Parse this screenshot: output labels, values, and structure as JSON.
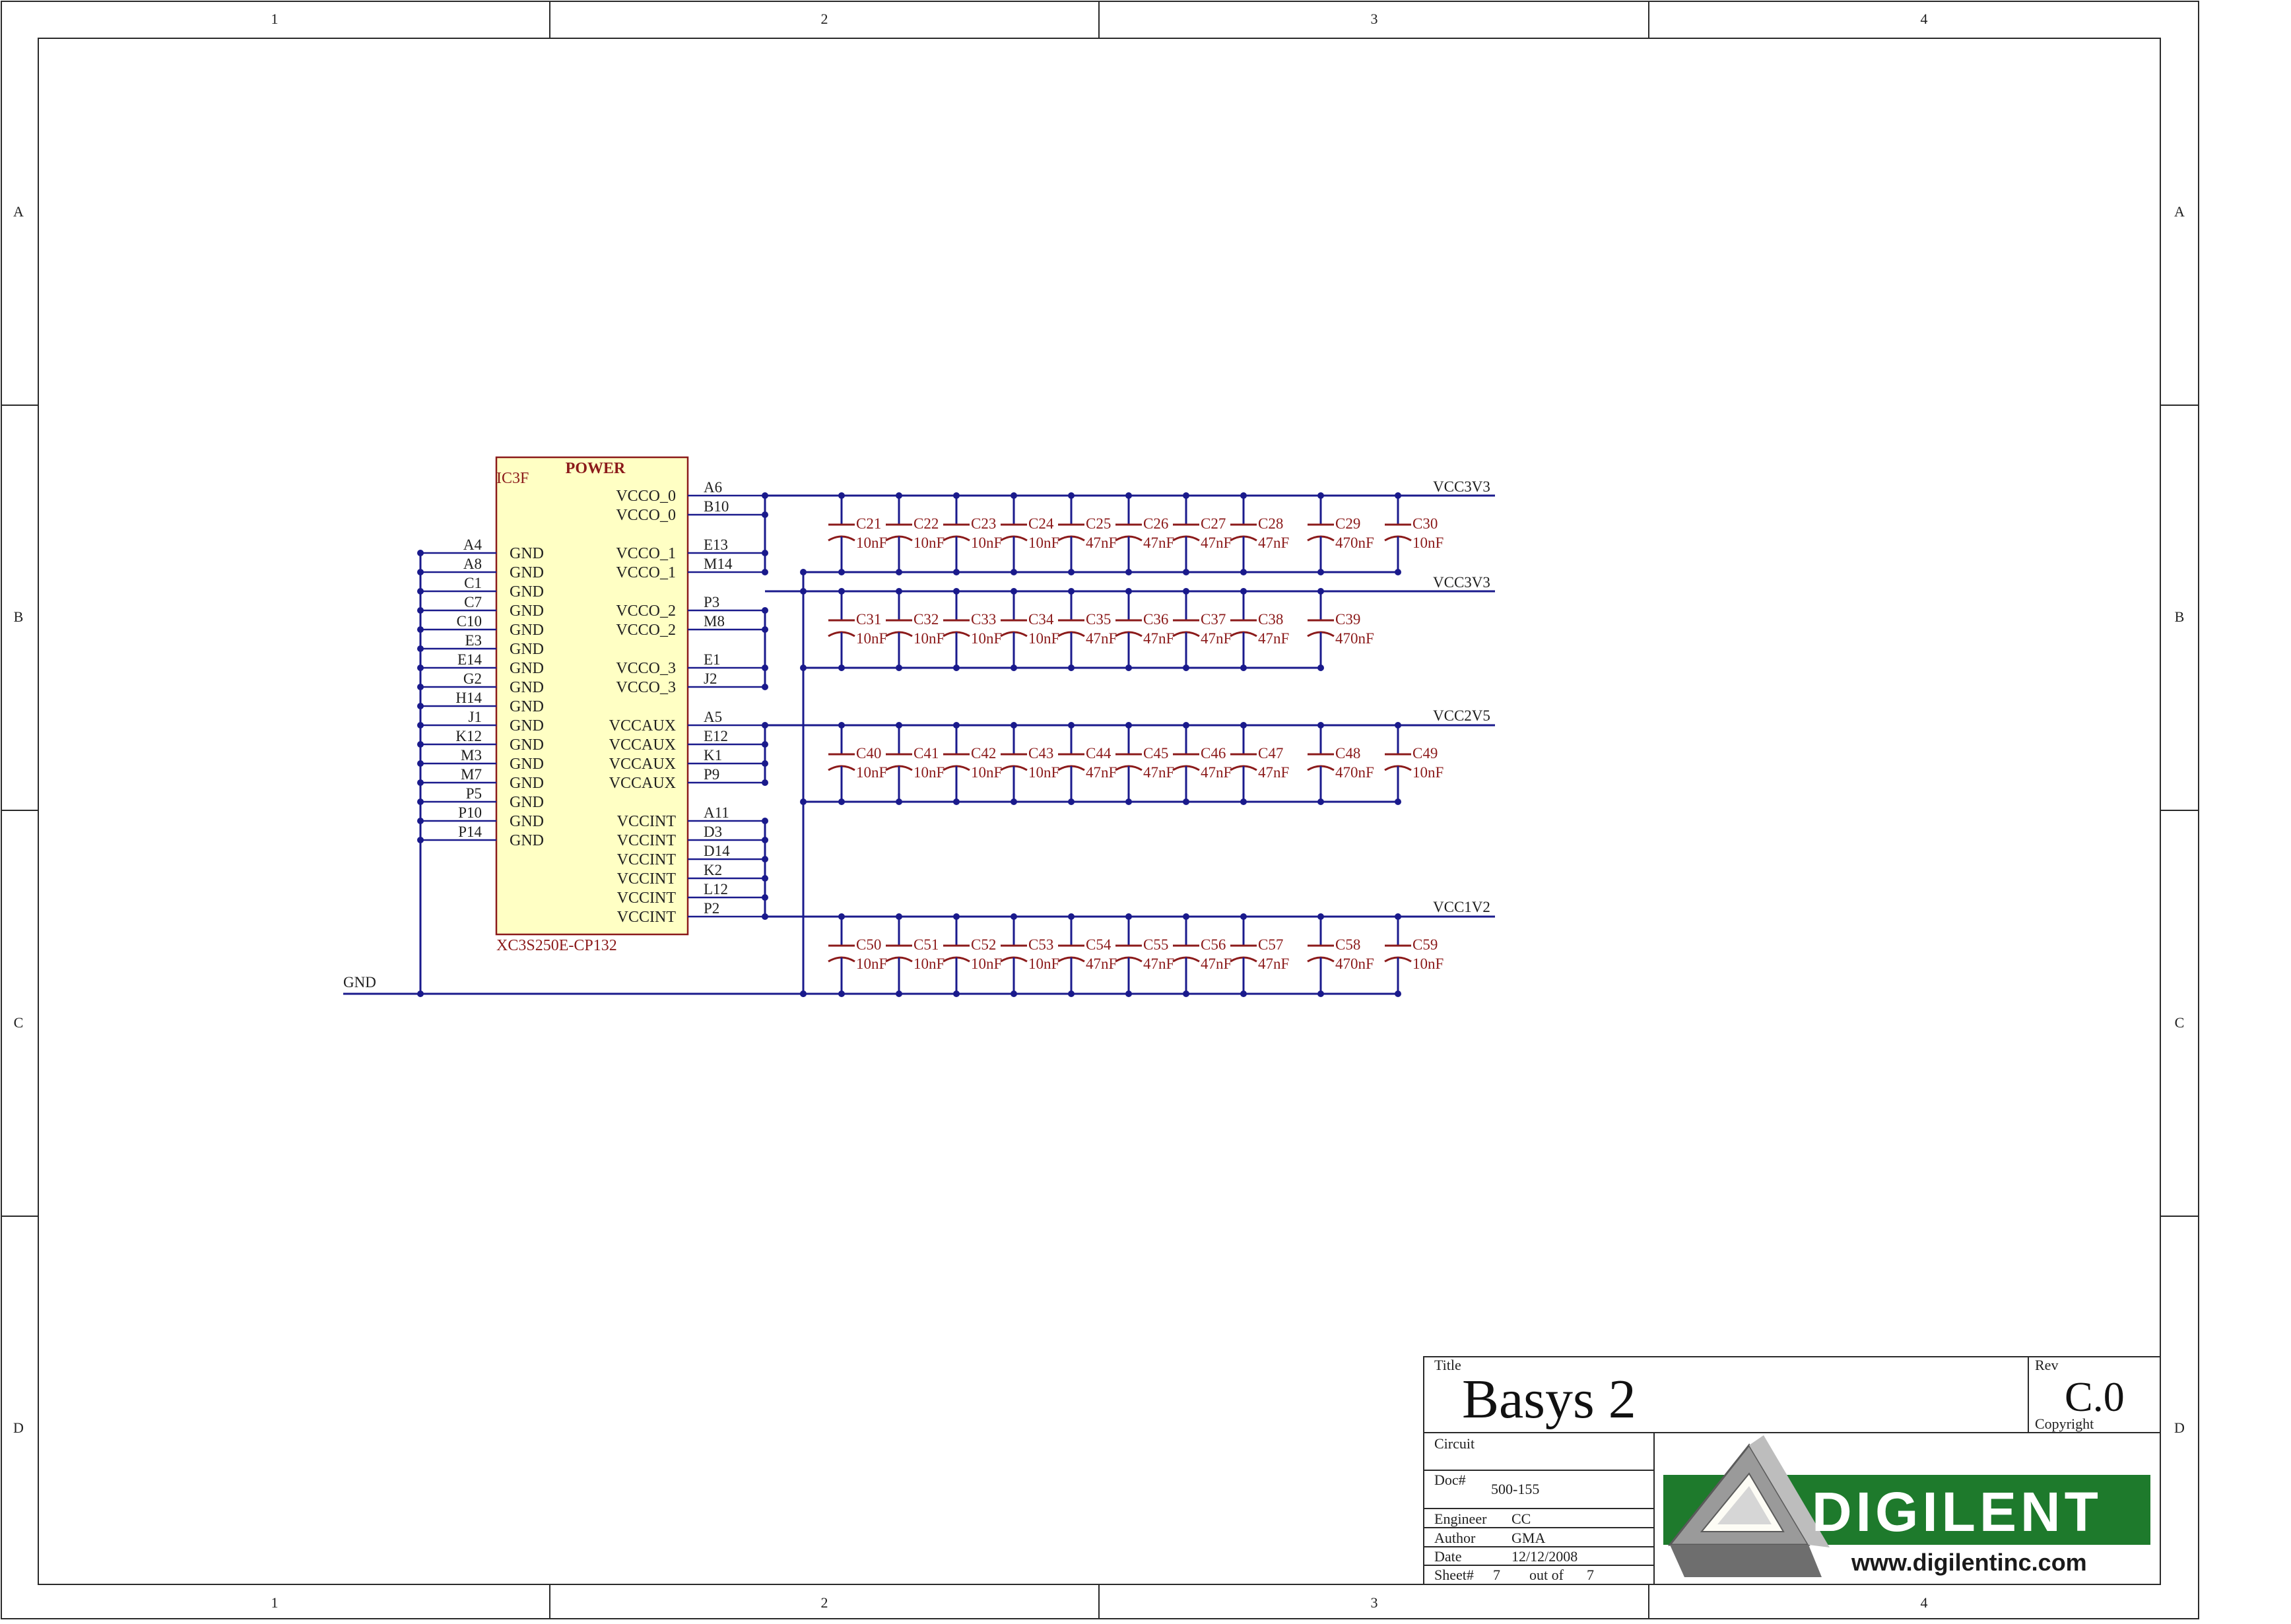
{
  "zones": {
    "cols": [
      "1",
      "2",
      "3",
      "4"
    ],
    "rows": [
      "A",
      "B",
      "C",
      "D"
    ]
  },
  "ic": {
    "ref": "IC3F",
    "part": "POWER",
    "device": "XC3S250E-CP132",
    "right_pins": [
      {
        "name": "VCCO_0",
        "num": "A6"
      },
      {
        "name": "VCCO_0",
        "num": "B10"
      },
      {
        "name": "VCCO_1",
        "num": "E13"
      },
      {
        "name": "VCCO_1",
        "num": "M14"
      },
      {
        "name": "VCCO_2",
        "num": "P3"
      },
      {
        "name": "VCCO_2",
        "num": "M8"
      },
      {
        "name": "VCCO_3",
        "num": "E1"
      },
      {
        "name": "VCCO_3",
        "num": "J2"
      },
      {
        "name": "VCCAUX",
        "num": "A5"
      },
      {
        "name": "VCCAUX",
        "num": "E12"
      },
      {
        "name": "VCCAUX",
        "num": "K1"
      },
      {
        "name": "VCCAUX",
        "num": "P9"
      },
      {
        "name": "VCCINT",
        "num": "A11"
      },
      {
        "name": "VCCINT",
        "num": "D3"
      },
      {
        "name": "VCCINT",
        "num": "D14"
      },
      {
        "name": "VCCINT",
        "num": "K2"
      },
      {
        "name": "VCCINT",
        "num": "L12"
      },
      {
        "name": "VCCINT",
        "num": "P2"
      }
    ],
    "left_pins": [
      {
        "name": "GND",
        "num": "A4"
      },
      {
        "name": "GND",
        "num": "A8"
      },
      {
        "name": "GND",
        "num": "C1"
      },
      {
        "name": "GND",
        "num": "C7"
      },
      {
        "name": "GND",
        "num": "C10"
      },
      {
        "name": "GND",
        "num": "E3"
      },
      {
        "name": "GND",
        "num": "E14"
      },
      {
        "name": "GND",
        "num": "G2"
      },
      {
        "name": "GND",
        "num": "H14"
      },
      {
        "name": "GND",
        "num": "J1"
      },
      {
        "name": "GND",
        "num": "K12"
      },
      {
        "name": "GND",
        "num": "M3"
      },
      {
        "name": "GND",
        "num": "M7"
      },
      {
        "name": "GND",
        "num": "P5"
      },
      {
        "name": "GND",
        "num": "P10"
      },
      {
        "name": "GND",
        "num": "P14"
      }
    ]
  },
  "nets": {
    "gnd": "GND",
    "rails": [
      "VCC3V3",
      "VCC3V3",
      "VCC2V5",
      "VCC1V2"
    ]
  },
  "cap_rows": [
    [
      {
        "ref": "C21",
        "val": "10nF"
      },
      {
        "ref": "C22",
        "val": "10nF"
      },
      {
        "ref": "C23",
        "val": "10nF"
      },
      {
        "ref": "C24",
        "val": "10nF"
      },
      {
        "ref": "C25",
        "val": "47nF"
      },
      {
        "ref": "C26",
        "val": "47nF"
      },
      {
        "ref": "C27",
        "val": "47nF"
      },
      {
        "ref": "C28",
        "val": "47nF"
      },
      {
        "ref": "C29",
        "val": "470nF"
      },
      {
        "ref": "C30",
        "val": "10nF"
      }
    ],
    [
      {
        "ref": "C31",
        "val": "10nF"
      },
      {
        "ref": "C32",
        "val": "10nF"
      },
      {
        "ref": "C33",
        "val": "10nF"
      },
      {
        "ref": "C34",
        "val": "10nF"
      },
      {
        "ref": "C35",
        "val": "47nF"
      },
      {
        "ref": "C36",
        "val": "47nF"
      },
      {
        "ref": "C37",
        "val": "47nF"
      },
      {
        "ref": "C38",
        "val": "47nF"
      },
      {
        "ref": "C39",
        "val": "470nF"
      }
    ],
    [
      {
        "ref": "C40",
        "val": "10nF"
      },
      {
        "ref": "C41",
        "val": "10nF"
      },
      {
        "ref": "C42",
        "val": "10nF"
      },
      {
        "ref": "C43",
        "val": "10nF"
      },
      {
        "ref": "C44",
        "val": "47nF"
      },
      {
        "ref": "C45",
        "val": "47nF"
      },
      {
        "ref": "C46",
        "val": "47nF"
      },
      {
        "ref": "C47",
        "val": "47nF"
      },
      {
        "ref": "C48",
        "val": "470nF"
      },
      {
        "ref": "C49",
        "val": "10nF"
      }
    ],
    [
      {
        "ref": "C50",
        "val": "10nF"
      },
      {
        "ref": "C51",
        "val": "10nF"
      },
      {
        "ref": "C52",
        "val": "10nF"
      },
      {
        "ref": "C53",
        "val": "10nF"
      },
      {
        "ref": "C54",
        "val": "47nF"
      },
      {
        "ref": "C55",
        "val": "47nF"
      },
      {
        "ref": "C56",
        "val": "47nF"
      },
      {
        "ref": "C57",
        "val": "47nF"
      },
      {
        "ref": "C58",
        "val": "470nF"
      },
      {
        "ref": "C59",
        "val": "10nF"
      }
    ]
  ],
  "title_block": {
    "title_label": "Title",
    "title": "Basys 2",
    "rev_label": "Rev",
    "rev": "C.0",
    "copyright_label": "Copyright",
    "circuit_label": "Circuit",
    "doc_label": "Doc#",
    "doc": "500-155",
    "engineer_label": "Engineer",
    "engineer": "CC",
    "author_label": "Author",
    "author": "GMA",
    "date_label": "Date",
    "date": "12/12/2008",
    "sheet_label": "Sheet#",
    "sheet": "7",
    "outof_label": "out of",
    "sheets": "7"
  },
  "logo": {
    "brand": "DIGILENT",
    "url": "www.digilentinc.com",
    "green": "#1e7a2c",
    "gray": "#8c8c8c"
  },
  "colors": {
    "wire": "#1a1a8c",
    "component": "#8b1a1a",
    "ic_fill": "#ffffc4"
  }
}
